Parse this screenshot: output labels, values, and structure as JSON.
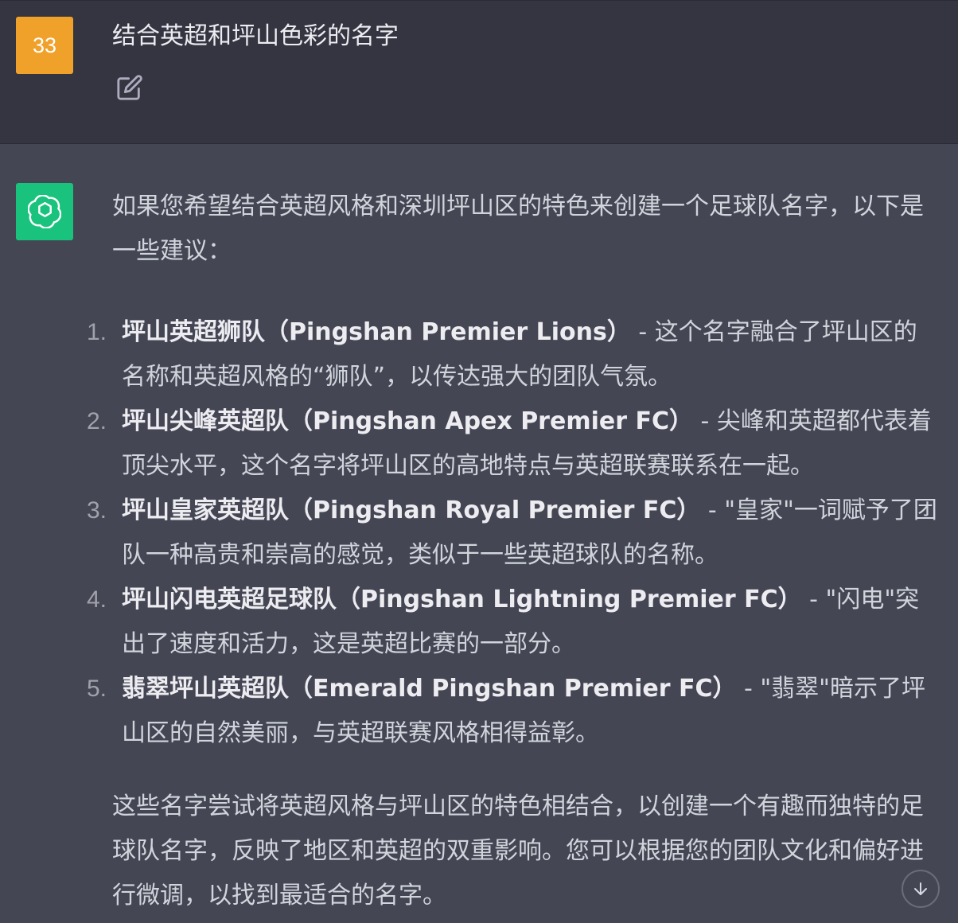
{
  "user_message": {
    "avatar_label": "33",
    "text": "结合英超和坪山色彩的名字",
    "edit_icon": "edit-icon",
    "avatar_color": "#f0a12a"
  },
  "assistant_message": {
    "avatar_icon": "openai-logo-icon",
    "avatar_color": "#19c37d",
    "intro": "如果您希望结合英超风格和深圳坪山区的特色来创建一个足球队名字，以下是一些建议：",
    "items": [
      {
        "number": "1.",
        "title": "坪山英超狮队（Pingshan Premier Lions）",
        "desc": " - 这个名字融合了坪山区的名称和英超风格的“狮队”，以传达强大的团队气氛。"
      },
      {
        "number": "2.",
        "title": "坪山尖峰英超队（Pingshan Apex Premier FC）",
        "desc": " - 尖峰和英超都代表着顶尖水平，这个名字将坪山区的高地特点与英超联赛联系在一起。"
      },
      {
        "number": "3.",
        "title": "坪山皇家英超队（Pingshan Royal Premier FC）",
        "desc": " - \"皇家\"一词赋予了团队一种高贵和崇高的感觉，类似于一些英超球队的名称。"
      },
      {
        "number": "4.",
        "title": "坪山闪电英超足球队（Pingshan Lightning Premier FC）",
        "desc": " - \"闪电\"突出了速度和活力，这是英超比赛的一部分。"
      },
      {
        "number": "5.",
        "title": "翡翠坪山英超队（Emerald Pingshan Premier FC）",
        "desc": " - \"翡翠\"暗示了坪山区的自然美丽，与英超联赛风格相得益彰。"
      }
    ],
    "conclusion": "这些名字尝试将英超风格与坪山区的特色相结合，以创建一个有趣而独特的足球队名字，反映了地区和英超的双重影响。您可以根据您的团队文化和偏好进行微调，以找到最适合的名字。"
  },
  "scroll_button": {
    "icon": "arrow-down-icon"
  }
}
